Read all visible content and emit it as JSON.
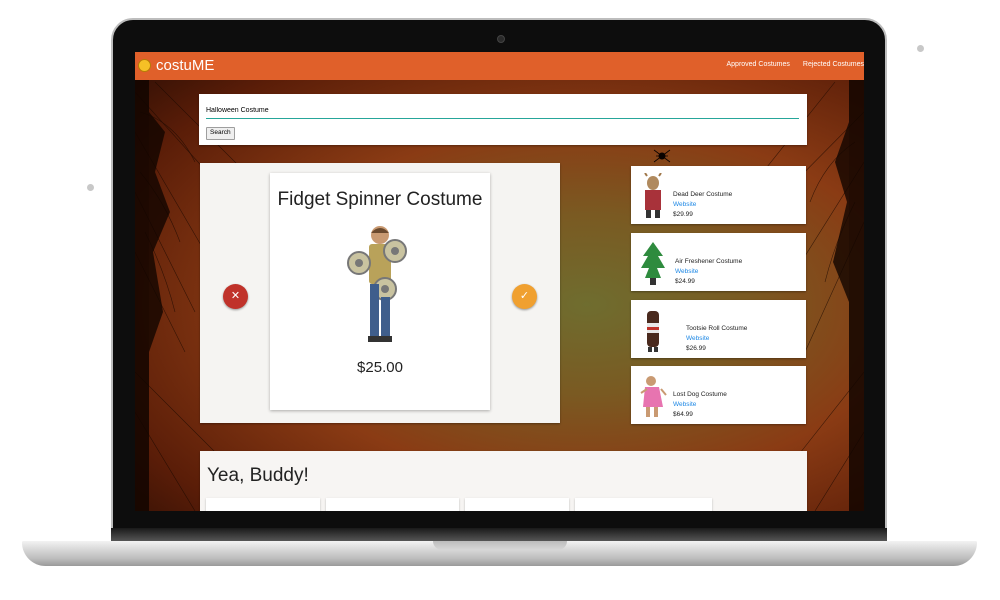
{
  "app": {
    "brand": "costuME"
  },
  "nav": {
    "links": [
      "Approved Costumes",
      "Rejected Costumes"
    ]
  },
  "search": {
    "value": "Halloween Costume",
    "button_label": "Search"
  },
  "current": {
    "title": "Fidget Spinner Costume",
    "price": "$25.00",
    "reject_icon": "✕",
    "approve_icon": "✓"
  },
  "sidebar": {
    "link_label": "Website",
    "items": [
      {
        "name": "Dead Deer Costume",
        "link": "Website",
        "price": "$29.99"
      },
      {
        "name": "Air Freshener Costume",
        "link": "Website",
        "price": "$24.99"
      },
      {
        "name": "Tootsie Roll Costume",
        "link": "Website",
        "price": "$26.99"
      },
      {
        "name": "Lost Dog Costume",
        "link": "Website",
        "price": "$64.99"
      }
    ]
  },
  "approved_section": {
    "title": "Yea, Buddy!"
  },
  "colors": {
    "nav": "#e0602a",
    "reject": "#c0322a",
    "approve": "#f0a030",
    "link": "#1e88e5"
  }
}
